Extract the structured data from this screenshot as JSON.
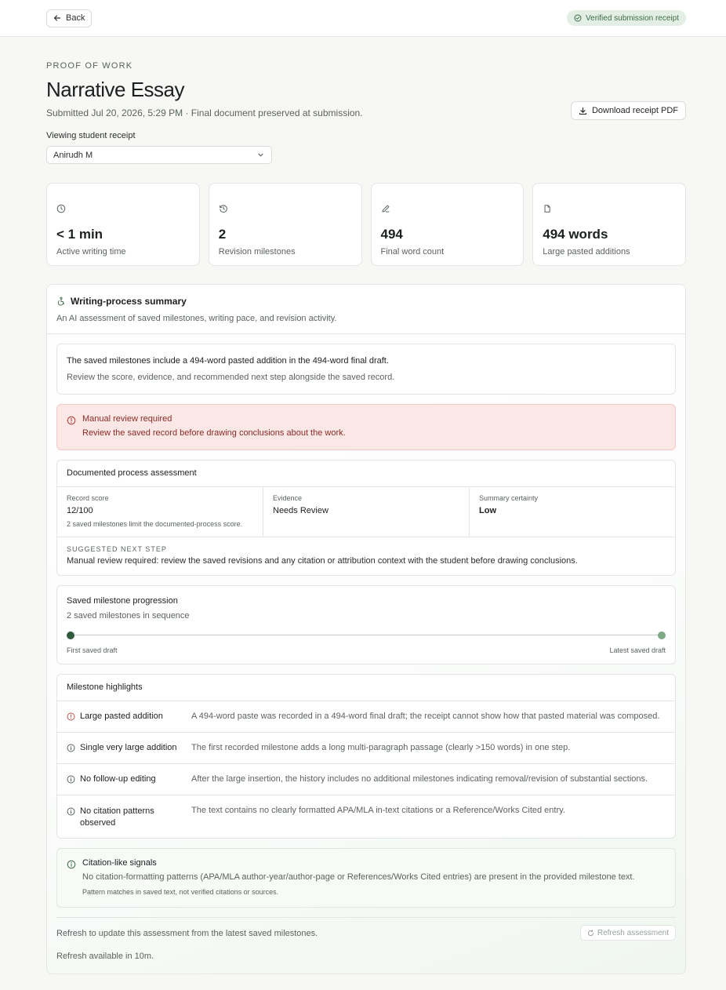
{
  "topbar": {
    "back_label": "Back",
    "verified_label": "Verified submission receipt"
  },
  "header": {
    "eyebrow": "PROOF OF WORK",
    "title": "Narrative Essay",
    "subtitle": "Submitted Jul 20, 2026, 5:29 PM · Final document preserved at submission.",
    "download_label": "Download receipt PDF",
    "viewing_label": "Viewing student receipt",
    "selected_student": "Anirudh M"
  },
  "stats": [
    {
      "icon": "clock-icon",
      "value": "< 1 min",
      "label": "Active writing time"
    },
    {
      "icon": "history-icon",
      "value": "2",
      "label": "Revision milestones"
    },
    {
      "icon": "pencil-icon",
      "value": "494",
      "label": "Final word count"
    },
    {
      "icon": "clipboard-icon",
      "value": "494 words",
      "label": "Large pasted additions"
    }
  ],
  "summary": {
    "title": "Writing-process summary",
    "description": "An AI assessment of saved milestones, writing pace, and revision activity.",
    "intro_strong": "The saved milestones include a 494-word pasted addition in the 494-word final draft.",
    "intro_text": "Review the score, evidence, and recommended next step alongside the saved record.",
    "alert_title": "Manual review required",
    "alert_text": "Review the saved record before drawing conclusions about the work.",
    "assessment": {
      "title": "Documented process assessment",
      "record_score_label": "Record score",
      "record_score_value": "12/100",
      "record_score_note": "2 saved milestones limit the documented-process score.",
      "evidence_label": "Evidence",
      "evidence_value": "Needs Review",
      "certainty_label": "Summary certainty",
      "certainty_value": "Low",
      "next_step_label": "SUGGESTED NEXT STEP",
      "next_step_text": "Manual review required: review the saved revisions and any citation or attribution context with the student before drawing conclusions."
    },
    "progression": {
      "title": "Saved milestone progression",
      "subtitle": "2 saved milestones in sequence",
      "first_label": "First saved draft",
      "last_label": "Latest saved draft"
    },
    "highlights": {
      "title": "Milestone highlights",
      "items": [
        {
          "name": "Large pasted addition",
          "desc": "A 494-word paste was recorded in a 494-word final draft; the receipt cannot show how that pasted material was composed.",
          "severity": "warning"
        },
        {
          "name": "Single very large addition",
          "desc": "The first recorded milestone adds a long multi-paragraph passage (clearly >150 words) in one step.",
          "severity": "info"
        },
        {
          "name": "No follow-up editing",
          "desc": "After the large insertion, the history includes no additional milestones indicating removal/revision of substantial sections.",
          "severity": "info"
        },
        {
          "name": "No citation patterns observed",
          "desc": "The text contains no clearly formatted APA/MLA in-text citations or a Reference/Works Cited entry.",
          "severity": "info"
        }
      ]
    },
    "citation": {
      "title": "Citation-like signals",
      "text": "No citation-formatting patterns (APA/MLA author-year/author-page or References/Works Cited entries) are present in the provided milestone text.",
      "note": "Pattern matches in saved text, not verified citations or sources."
    },
    "footer": {
      "refresh_text": "Refresh to update this assessment from the latest saved milestones.",
      "refresh_button": "Refresh assessment",
      "refresh_available": "Refresh available in 10m."
    }
  },
  "colors": {
    "accent": "#2f5a3b",
    "alert_bg": "#fbe7e6",
    "alert_text": "#8a2b25",
    "verified_bg": "#e3efe4"
  }
}
